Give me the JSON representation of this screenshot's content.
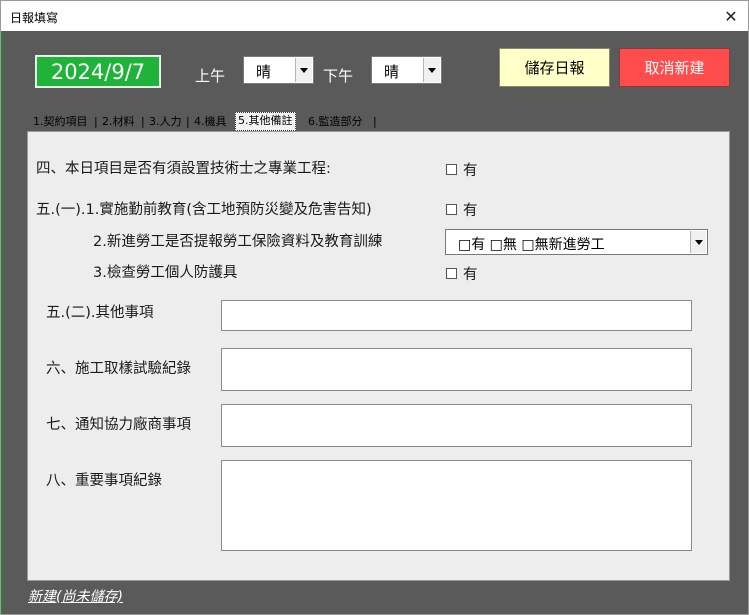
{
  "window": {
    "title": "日報填寫",
    "close_glyph": "✕"
  },
  "header": {
    "date": "2024/9/7",
    "morning_label": "上午",
    "morning_weather": "晴",
    "afternoon_label": "下午",
    "afternoon_weather": "晴",
    "save_label": "儲存日報",
    "cancel_label": "取消新建"
  },
  "tabs": [
    {
      "label": "1.契約項目"
    },
    {
      "label": "2.材料"
    },
    {
      "label": "3.人力"
    },
    {
      "label": "4.機具"
    },
    {
      "label": "5.其他備註",
      "active": true
    },
    {
      "label": "6.監造部分"
    }
  ],
  "tab_separator": "|",
  "form": {
    "item4_label": "四、本日項目是否有須設置技術士之專業工程:",
    "item4_check": "有",
    "item5_1_label": "五.(一).1.實施勤前教育(含工地預防災變及危害告知)",
    "item5_1_check": "有",
    "item5_2_label": "2.新進勞工是否提報勞工保險資料及教育訓練",
    "item5_2_value": "□有 □無 □無新進勞工",
    "item5_3_label": "3.檢查勞工個人防護具",
    "item5_3_check": "有",
    "item5b_label": "五.(二).其他事項",
    "item6_label": "六、施工取樣試驗紀錄",
    "item7_label": "七、通知協力廠商事項",
    "item8_label": "八、重要事項紀錄"
  },
  "status": "新建(尚未儲存)",
  "colors": {
    "date_bg": "#1fb33a",
    "save_bg": "#ffffc8",
    "cancel_bg": "#ff4d4d",
    "client_bg": "#5a5a5a"
  }
}
